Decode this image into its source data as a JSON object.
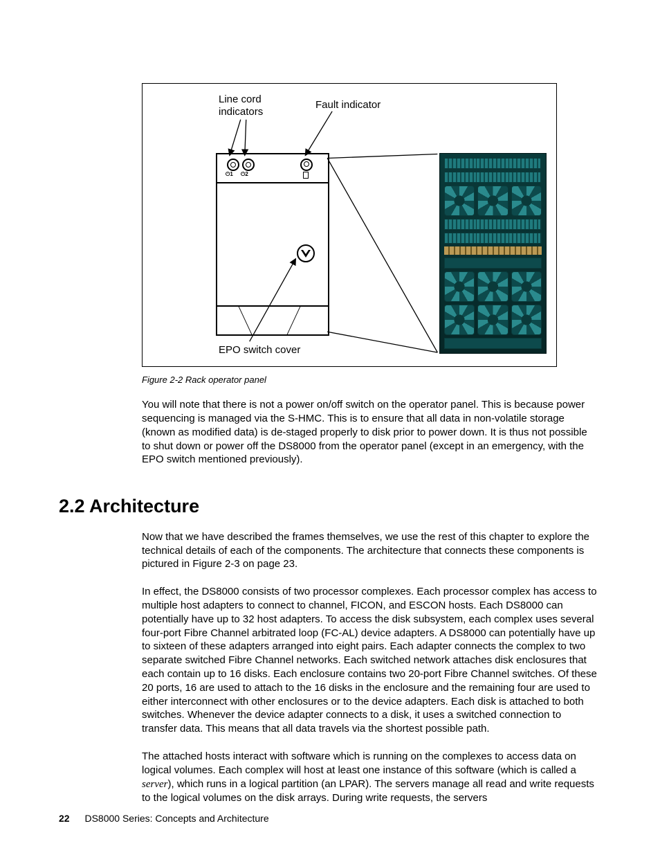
{
  "figure": {
    "label_linecord": "Line cord\nindicators",
    "label_fault": "Fault indicator",
    "label_epo": "EPO switch cover",
    "led1_sub": "1",
    "led2_sub": "2",
    "caption": "Figure 2-2   Rack operator panel"
  },
  "para1": "You will note that there is not a power on/off switch on the operator panel. This is because power sequencing is managed via the S-HMC. This is to ensure that all data in non-volatile storage (known as modified data) is de-staged properly to disk prior to power down. It is thus not possible to shut down or power off the DS8000 from the operator panel (except in an emergency, with the EPO switch mentioned previously).",
  "section_heading": "2.2  Architecture",
  "para2": "Now that we have described the frames themselves, we use the rest of this chapter to explore the technical details of each of the components. The architecture that connects these components is pictured in Figure 2-3 on page 23.",
  "para3": "In effect, the DS8000 consists of two processor complexes. Each processor complex has access to multiple host adapters to connect to channel, FICON, and ESCON hosts. Each DS8000 can potentially have up to 32 host adapters. To access the disk subsystem, each complex uses several four-port Fibre Channel arbitrated loop (FC-AL) device adapters. A DS8000 can potentially have up to sixteen of these adapters arranged into eight pairs. Each adapter connects the complex to two separate switched Fibre Channel networks. Each switched network attaches disk enclosures that each contain up to 16 disks. Each enclosure contains two 20-port Fibre Channel switches. Of these 20 ports, 16 are used to attach to the 16 disks in the enclosure and the remaining four are used to either interconnect with other enclosures or to the device adapters. Each disk is attached to both switches. Whenever the device adapter connects to a disk, it uses a switched connection to transfer data. This means that all data travels via the shortest possible path.",
  "para4_a": "The attached hosts interact with software which is running on the complexes to access data on logical volumes. Each complex will host at least one instance of this software (which is called a ",
  "para4_italic": "server",
  "para4_b": "), which runs in a logical partition (an LPAR). The servers manage all read and write requests to the logical volumes on the disk arrays. During write requests, the servers",
  "footer": {
    "page_number": "22",
    "book_title": "DS8000 Series: Concepts and Architecture"
  }
}
